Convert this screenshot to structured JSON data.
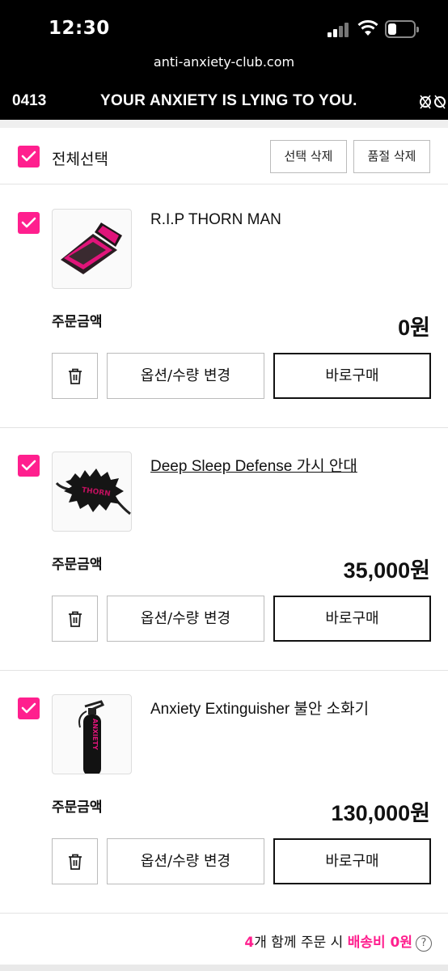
{
  "status_bar": {
    "time": "12:30"
  },
  "browser": {
    "url": "anti-anxiety-club.com"
  },
  "marquee": {
    "number": "0413",
    "text": "YOUR ANXIETY IS LYING TO YOU."
  },
  "cart": {
    "select_all_label": "전체선택",
    "delete_selected_label": "선택 삭제",
    "delete_soldout_label": "품절 삭제",
    "items": [
      {
        "name": "R.I.P THORN MAN",
        "order_amount_label": "주문금액",
        "price": "0원",
        "option_button": "옵션/수량 변경",
        "buy_button": "바로구매"
      },
      {
        "name": "Deep Sleep Defense 가시 안대",
        "order_amount_label": "주문금액",
        "price": "35,000원",
        "option_button": "옵션/수량 변경",
        "buy_button": "바로구매"
      },
      {
        "name": "Anxiety Extinguisher 불안 소화기",
        "order_amount_label": "주문금액",
        "price": "130,000원",
        "option_button": "옵션/수량 변경",
        "buy_button": "바로구매"
      }
    ]
  },
  "shipping_note": {
    "count": "4",
    "text_middle": "개 함께 주문 시 ",
    "highlight": "배송비 0원"
  },
  "colors": {
    "accent": "#ff1f8e",
    "header_bg": "#000000"
  },
  "icons": [
    "signal-icon",
    "wifi-icon",
    "battery-icon",
    "checkbox-checked-icon",
    "trash-icon",
    "help-circle-icon"
  ]
}
